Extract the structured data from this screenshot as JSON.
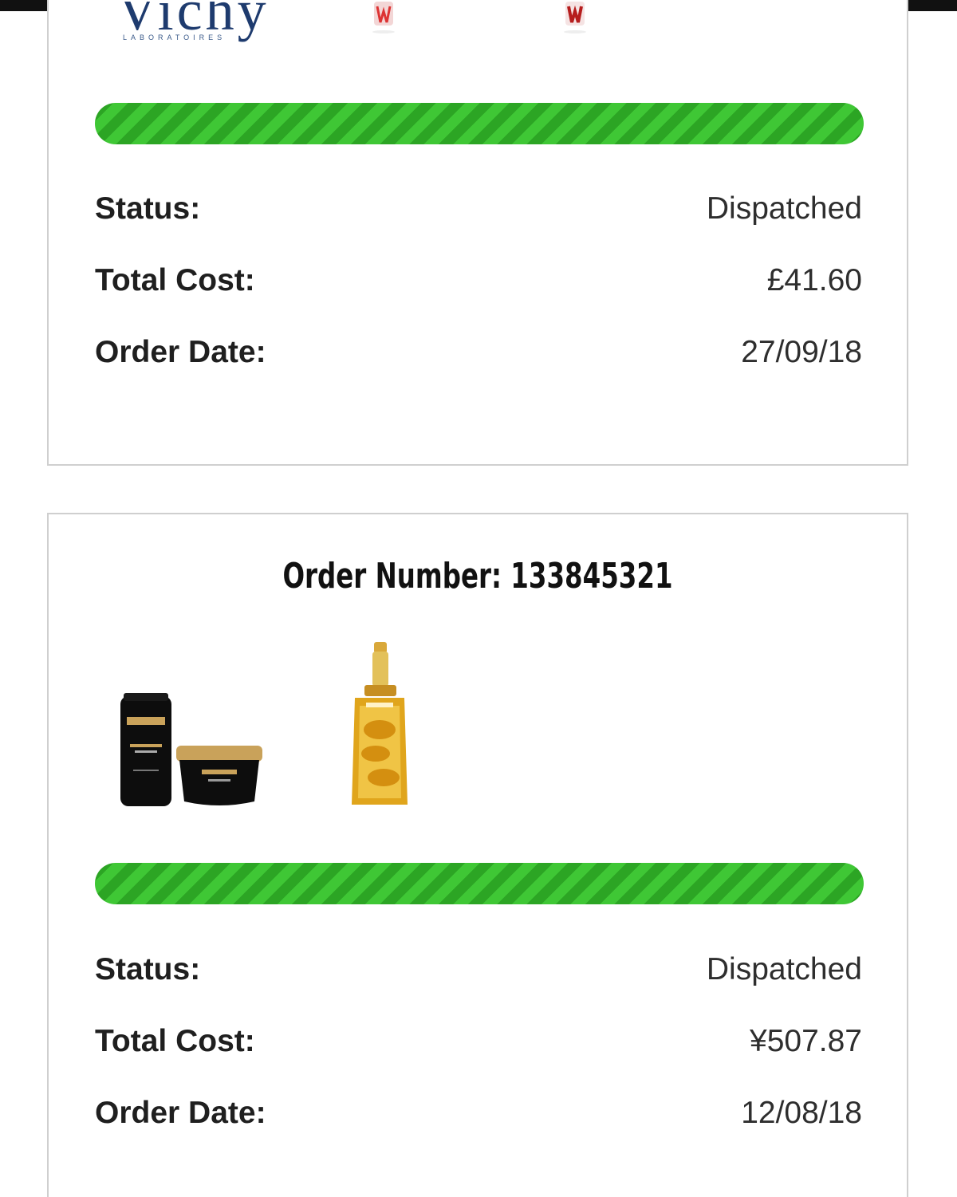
{
  "colors": {
    "progress_green": "#33b82a",
    "progress_stripe": "#2ca524",
    "card_border": "#cfcfcf",
    "label_text": "#1f1f1f",
    "value_text": "#2e2e2e",
    "top_strip": "#111111"
  },
  "orders": [
    {
      "brand_logo": {
        "word": "Vichy",
        "sub": "LABORATOIRES"
      },
      "progress_fraction": 1.0,
      "status_label": "Status:",
      "status_value": "Dispatched",
      "total_label": "Total Cost:",
      "total_value": "£41.60",
      "date_label": "Order Date:",
      "date_value": "27/09/18"
    },
    {
      "title": "Order Number: 133845321",
      "products": [
        {
          "icon": "shampoo-and-mask-set-icon"
        },
        {
          "icon": "hair-oil-bottle-icon"
        }
      ],
      "progress_fraction": 1.0,
      "status_label": "Status:",
      "status_value": "Dispatched",
      "total_label": "Total Cost:",
      "total_value": "¥507.87",
      "date_label": "Order Date:",
      "date_value": "12/08/18"
    }
  ]
}
